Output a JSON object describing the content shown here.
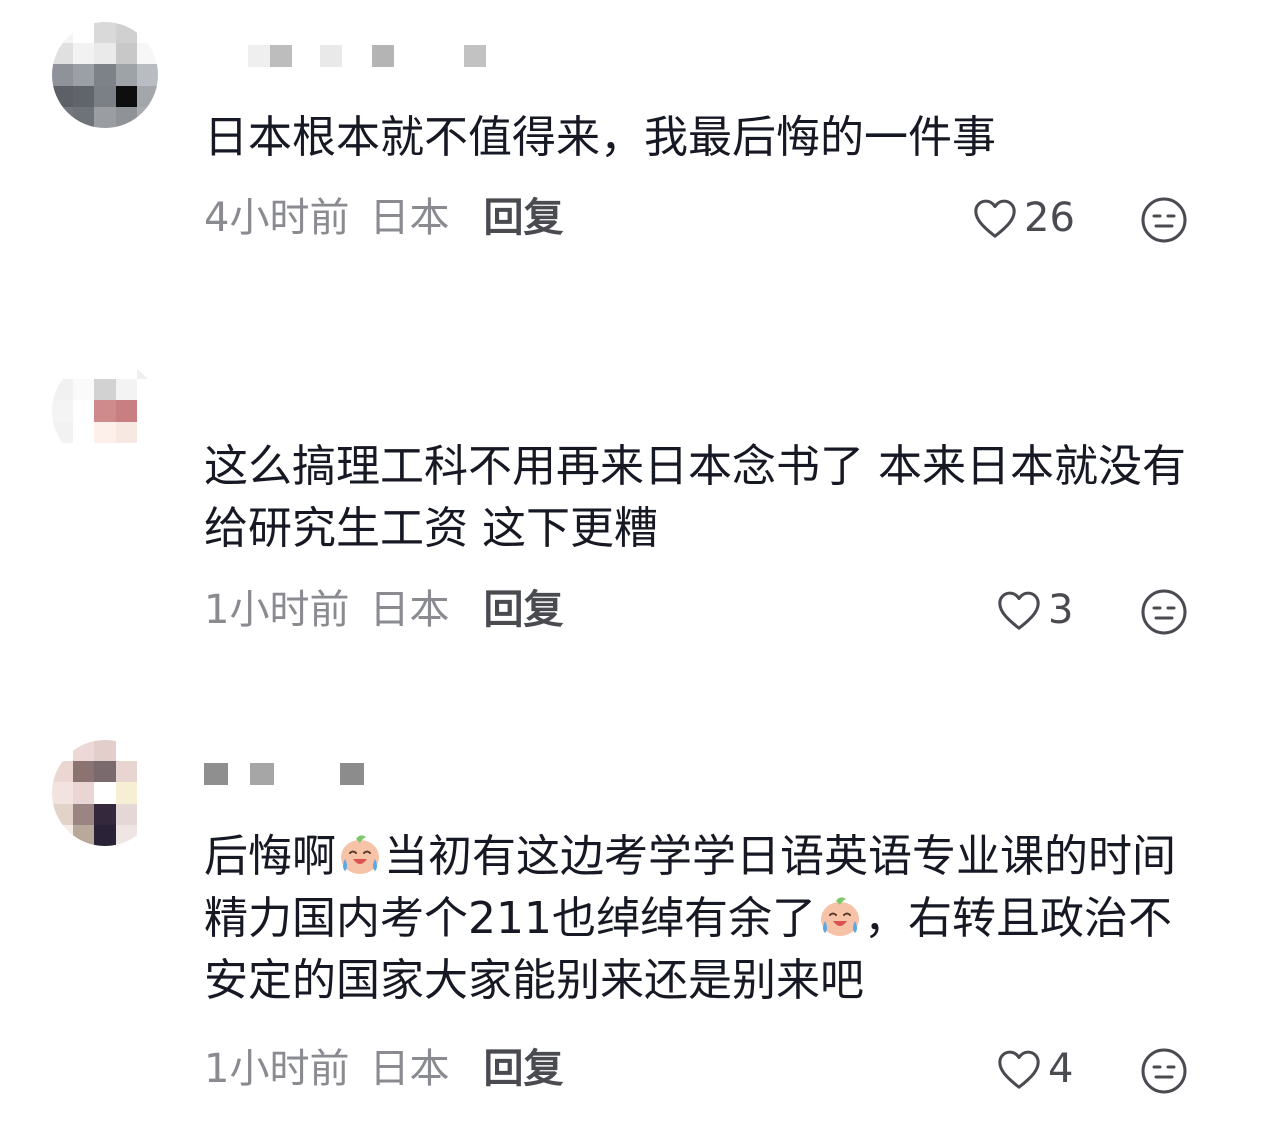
{
  "comments": [
    {
      "text": "日本根本就不值得来，我最后悔的一件事",
      "time": "4小时前",
      "location": "日本",
      "reply_label": "回复",
      "likes": "26"
    },
    {
      "text": "这么搞理工科不用再来日本念书了 本来日本就没有给研究生工资 这下更糟",
      "time": "1小时前",
      "location": "日本",
      "reply_label": "回复",
      "likes": "3"
    },
    {
      "text_part1": "后悔啊",
      "text_part2": "当初有这边考学学日语英语专业课的时间精力国内考个211也绰绰有余了",
      "text_part3": "，右转且政治不安定的国家大家能别来还是别来吧",
      "time": "1小时前",
      "location": "日本",
      "reply_label": "回复",
      "likes": "4"
    }
  ],
  "icons": {
    "like": "heart-outline-icon",
    "dislike": "neutral-face-icon",
    "emoji": "crying-laughing-peach-emoji"
  },
  "colors": {
    "text": "#161823",
    "meta": "#8a8b91",
    "reply": "#4a4b51"
  }
}
